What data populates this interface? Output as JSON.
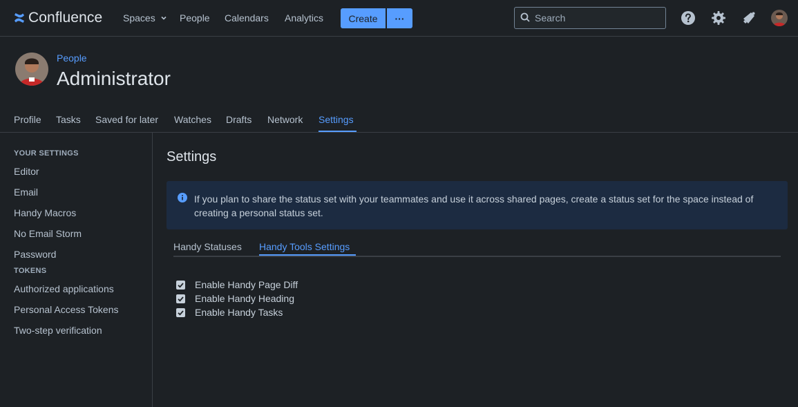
{
  "topnav": {
    "brand": "Confluence",
    "items": {
      "spaces": "Spaces",
      "people": "People",
      "calendars": "Calendars",
      "analytics": "Analytics"
    },
    "create_label": "Create",
    "more_label": "···",
    "search_placeholder": "Search"
  },
  "header": {
    "breadcrumb": "People",
    "title": "Administrator"
  },
  "tabs": [
    "Profile",
    "Tasks",
    "Saved for later",
    "Watches",
    "Drafts",
    "Network",
    "Settings"
  ],
  "active_tab": "Settings",
  "sidebar": {
    "section_settings": "YOUR SETTINGS",
    "settings_items": [
      "Editor",
      "Email",
      "Handy Macros",
      "No Email Storm",
      "Password"
    ],
    "section_tokens": "TOKENS",
    "token_items": [
      "Authorized applications",
      "Personal Access Tokens",
      "Two-step verification"
    ]
  },
  "main": {
    "title": "Settings",
    "info_message": "If you plan to share the status set with your teammates and use it across shared pages, create a status set for the space instead of creating a personal status set.",
    "subtabs": [
      "Handy Statuses",
      "Handy Tools Settings"
    ],
    "active_subtab": "Handy Tools Settings",
    "options": [
      {
        "label": "Enable Handy Page Diff",
        "checked": true
      },
      {
        "label": "Enable Handy Heading",
        "checked": true
      },
      {
        "label": "Enable Handy Tasks",
        "checked": true
      }
    ]
  },
  "colors": {
    "accent": "#579dff",
    "background": "#1d2125",
    "info_panel": "#1c2b41"
  }
}
